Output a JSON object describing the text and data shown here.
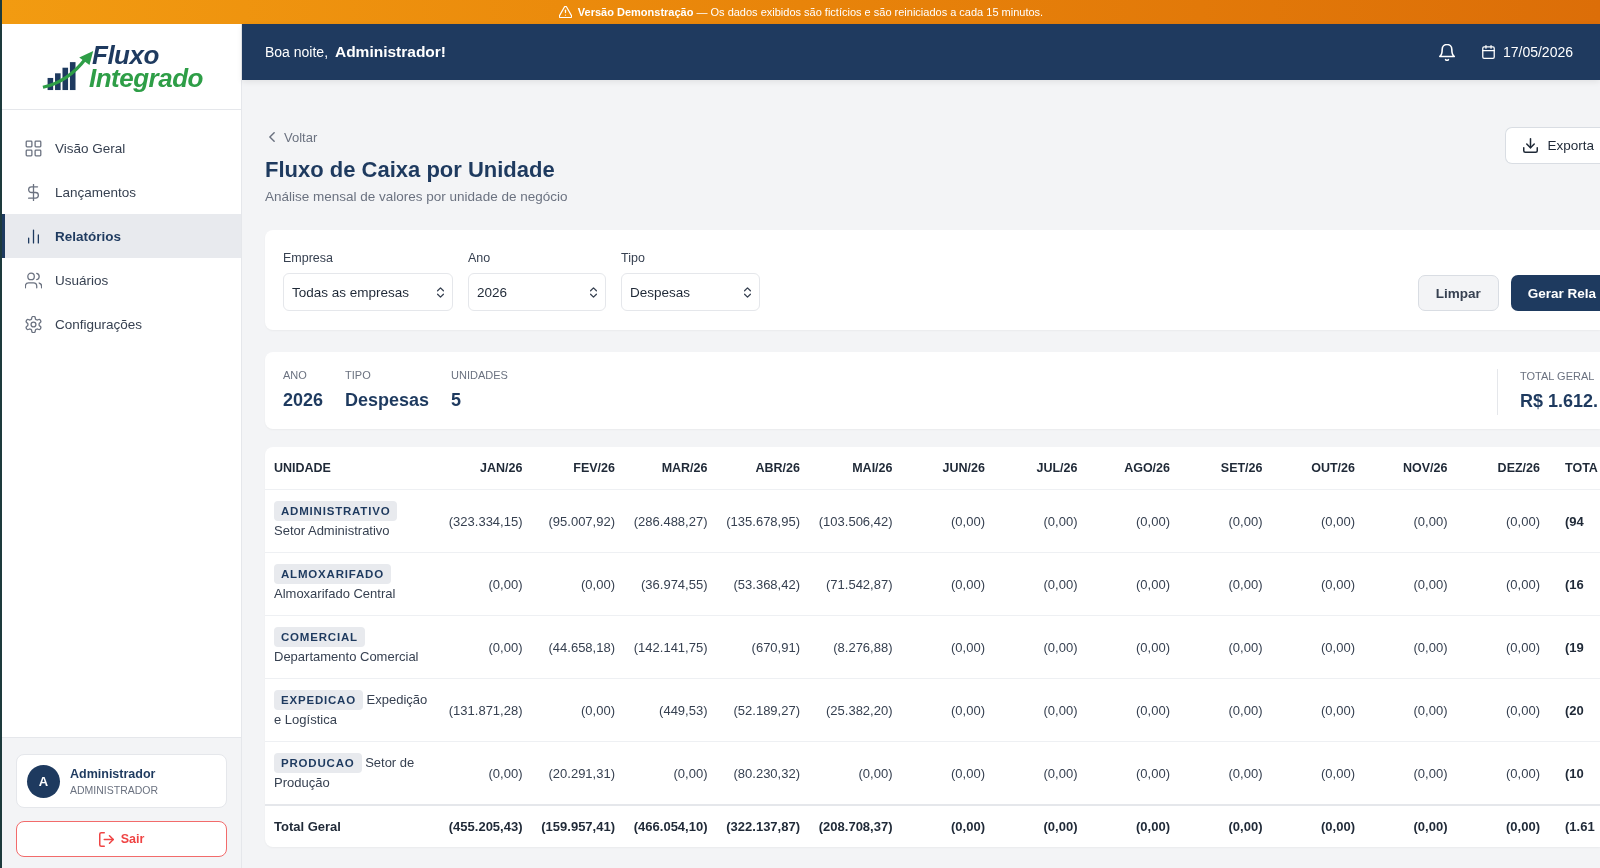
{
  "banner": {
    "text": "**Versão Demonstração** — Os dados exibidos são fictícios e são reiniciados a cada 15 minutos."
  },
  "sidebar": {
    "logo": {
      "line_1": "Fluxo",
      "line_2": "Integrado"
    },
    "items": [
      {
        "label": "Visão Geral",
        "selected": false
      },
      {
        "label": "Lançamentos",
        "selected": false
      },
      {
        "label": "Relatórios",
        "selected": true
      },
      {
        "label": "Usuários",
        "selected": false
      },
      {
        "label": "Configurações",
        "selected": false
      }
    ],
    "user": {
      "initial": "A",
      "name": "Administrador",
      "role": "ADMINISTRADOR"
    },
    "logout": "Sair"
  },
  "header": {
    "greeting": "Boa noite, **Administrador!**",
    "date": "17/05/2026"
  },
  "page": {
    "back": "Voltar",
    "title": "Fluxo de Caixa por Unidade",
    "subtitle": "Análise mensal de valores por unidade de negócio",
    "export": "Exporta"
  },
  "filters": {
    "fields": [
      {
        "label": "Empresa",
        "value": "Todas as empresas"
      },
      {
        "label": "Ano",
        "value": "2026"
      },
      {
        "label": "Tipo",
        "value": "Despesas"
      }
    ],
    "buttons": [
      {
        "label": "Limpar",
        "kind": "secondary"
      },
      {
        "label": "Gerar Rela",
        "kind": "primary"
      }
    ]
  },
  "summary": {
    "items": [
      {
        "label": "ANO",
        "value": "2026"
      },
      {
        "label": "TIPO",
        "value": "Despesas"
      },
      {
        "label": "UNIDADES",
        "value": "5"
      }
    ],
    "total": {
      "label": "TOTAL GERAL",
      "value": "R$ 1.612."
    }
  },
  "table": {
    "columns": [
      "UNIDADE",
      "JAN/26",
      "FEV/26",
      "MAR/26",
      "ABR/26",
      "MAI/26",
      "JUN/26",
      "JUL/26",
      "AGO/26",
      "SET/26",
      "OUT/26",
      "NOV/26",
      "DEZ/26",
      "TOTA"
    ],
    "rows": [
      {
        "code": "ADMINISTRATIVO",
        "name": "Setor Administrativo",
        "values": [
          "(323.334,15)",
          "(95.007,92)",
          "(286.488,27)",
          "(135.678,95)",
          "(103.506,42)",
          "(0,00)",
          "(0,00)",
          "(0,00)",
          "(0,00)",
          "(0,00)",
          "(0,00)",
          "(0,00)"
        ],
        "total": "(94"
      },
      {
        "code": "ALMOXARIFADO",
        "name": "Almoxarifado Central",
        "values": [
          "(0,00)",
          "(0,00)",
          "(36.974,55)",
          "(53.368,42)",
          "(71.542,87)",
          "(0,00)",
          "(0,00)",
          "(0,00)",
          "(0,00)",
          "(0,00)",
          "(0,00)",
          "(0,00)"
        ],
        "total": "(16"
      },
      {
        "code": "COMERCIAL",
        "name": "Departamento Comercial",
        "values": [
          "(0,00)",
          "(44.658,18)",
          "(142.141,75)",
          "(670,91)",
          "(8.276,88)",
          "(0,00)",
          "(0,00)",
          "(0,00)",
          "(0,00)",
          "(0,00)",
          "(0,00)",
          "(0,00)"
        ],
        "total": "(19"
      },
      {
        "code": "EXPEDICAO",
        "name": "Expedição e Logística",
        "values": [
          "(131.871,28)",
          "(0,00)",
          "(449,53)",
          "(52.189,27)",
          "(25.382,20)",
          "(0,00)",
          "(0,00)",
          "(0,00)",
          "(0,00)",
          "(0,00)",
          "(0,00)",
          "(0,00)"
        ],
        "total": "(20"
      },
      {
        "code": "PRODUCAO",
        "name": "Setor de Produção",
        "values": [
          "(0,00)",
          "(20.291,31)",
          "(0,00)",
          "(80.230,32)",
          "(0,00)",
          "(0,00)",
          "(0,00)",
          "(0,00)",
          "(0,00)",
          "(0,00)",
          "(0,00)",
          "(0,00)"
        ],
        "total": "(10"
      }
    ],
    "footer": {
      "label": "Total Geral",
      "values": [
        "(455.205,43)",
        "(159.957,41)",
        "(466.054,10)",
        "(322.137,87)",
        "(208.708,37)",
        "(0,00)",
        "(0,00)",
        "(0,00)",
        "(0,00)",
        "(0,00)",
        "(0,00)",
        "(0,00)"
      ],
      "total": "(1.61"
    }
  }
}
